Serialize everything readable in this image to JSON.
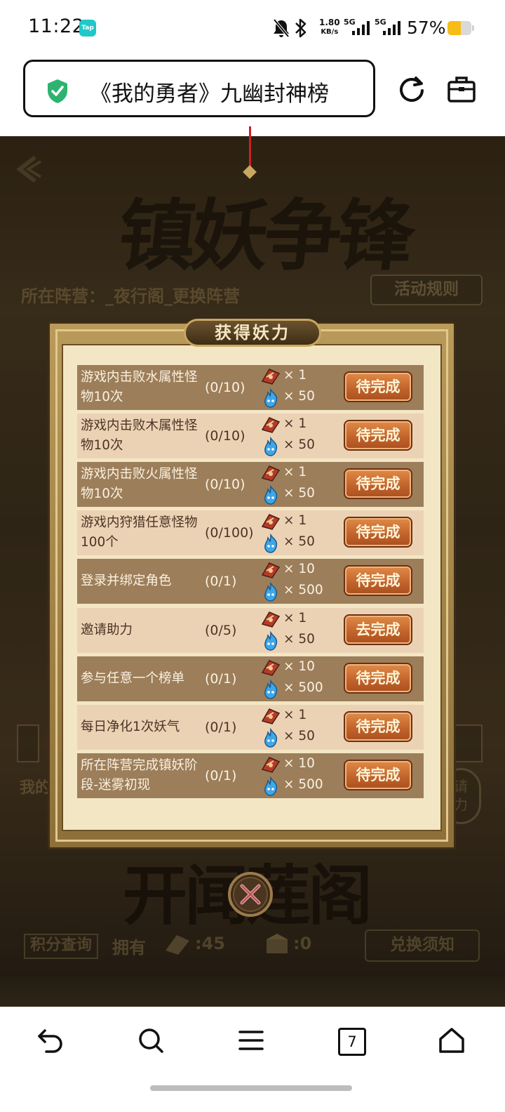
{
  "status_bar": {
    "time": "11:22",
    "tap_badge": "Tap",
    "net_speed_top": "1.80",
    "net_speed_unit": "KB/s",
    "signal1_label": "5G",
    "signal2_label": "5G",
    "battery_percent": "57%",
    "battery_level": 0.57,
    "icons": [
      "mute-icon",
      "bluetooth-icon",
      "signal-icon",
      "battery-icon"
    ]
  },
  "browser": {
    "page_title": "《我的勇者》九幽封神榜",
    "security_icon": "shield-check-icon",
    "accent_color": "#2db36f"
  },
  "game": {
    "title_art": "镇妖争锋",
    "faction_text": "所在阵营：_夜行阁_更换阵营",
    "rules_button": "活动规则",
    "my_label": "我的",
    "invite_text": "请\n力",
    "bottom_title_art": "开闻莲阁",
    "query_button": "积分查询",
    "own_label": "拥有",
    "own_value_1": ":45",
    "own_value_2": ":0",
    "exchange_button": "兑换须知"
  },
  "modal": {
    "title": "获得妖力",
    "tasks": [
      {
        "name": "游戏内击败水属性怪物10次",
        "progress": "(0/10)",
        "reward_a": "× 1",
        "reward_b": "× 50",
        "button": "待完成"
      },
      {
        "name": "游戏内击败木属性怪物10次",
        "progress": "(0/10)",
        "reward_a": "× 1",
        "reward_b": "× 50",
        "button": "待完成"
      },
      {
        "name": "游戏内击败火属性怪物10次",
        "progress": "(0/10)",
        "reward_a": "× 1",
        "reward_b": "× 50",
        "button": "待完成"
      },
      {
        "name": "游戏内狩猎任意怪物100个",
        "progress": "(0/100)",
        "reward_a": "× 1",
        "reward_b": "× 50",
        "button": "待完成"
      },
      {
        "name": "登录并绑定角色",
        "progress": "(0/1)",
        "reward_a": "× 10",
        "reward_b": "× 500",
        "button": "待完成"
      },
      {
        "name": "邀请助力",
        "progress": "(0/5)",
        "reward_a": "× 1",
        "reward_b": "× 50",
        "button": "去完成"
      },
      {
        "name": "参与任意一个榜单",
        "progress": "(0/1)",
        "reward_a": "× 10",
        "reward_b": "× 500",
        "button": "待完成"
      },
      {
        "name": "每日净化1次妖气",
        "progress": "(0/1)",
        "reward_a": "× 1",
        "reward_b": "× 50",
        "button": "待完成"
      },
      {
        "name": "所在阵营完成镇妖阶段-迷雾初现",
        "progress": "(0/1)",
        "reward_a": "× 10",
        "reward_b": "× 500",
        "button": "待完成"
      }
    ]
  },
  "nav": {
    "items": [
      "back-icon",
      "search-icon",
      "menu-icon",
      "tabs-icon",
      "home-icon"
    ],
    "tab_count": "7"
  }
}
